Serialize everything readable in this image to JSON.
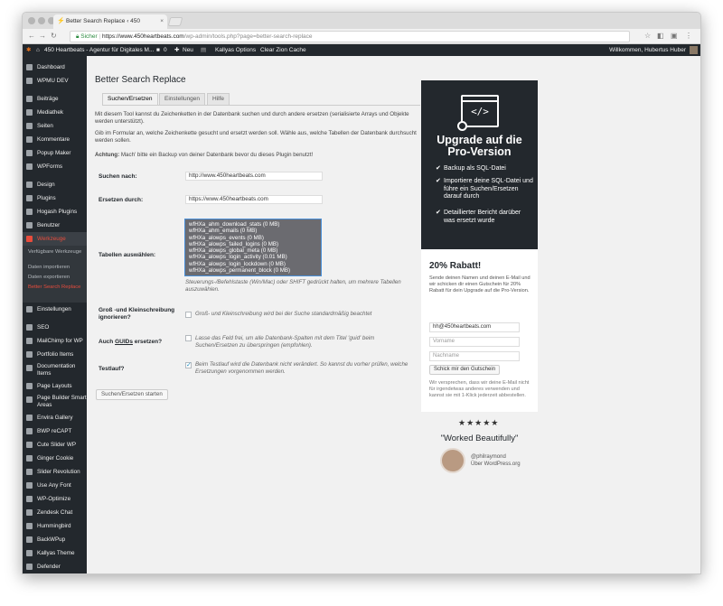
{
  "browser": {
    "tab_title": "Better Search Replace ‹ 450",
    "tab_close": "×",
    "secure_label": "Sicher",
    "url_host": "https://www.450heartbeats.com",
    "url_path": "/wp-admin/tools.php?page=better-search-replace"
  },
  "adminbar": {
    "site_name": "450 Heartbeats - Agentur für Digitales M...",
    "comments_count": "0",
    "new_label": "Neu",
    "kallyas_options": "Kallyas Options",
    "clear_cache": "Clear Zion Cache",
    "greeting": "Willkommen, Hubertus Huber"
  },
  "sidebar": {
    "items_top": [
      "Dashboard",
      "WPMU DEV"
    ],
    "items_main": [
      "Beiträge",
      "Mediathek",
      "Seiten",
      "Kommentare",
      "Popup Maker",
      "WPForms"
    ],
    "items_design": [
      "Design",
      "Plugins",
      "Hogash Plugins",
      "Benutzer"
    ],
    "active_item": "Werkzeuge",
    "submenu": [
      "Verfügbare Werkzeuge",
      "Daten importieren",
      "Daten exportieren",
      "Better Search Replace"
    ],
    "items_after": [
      "Einstellungen"
    ],
    "items_plugins": [
      "SEO",
      "MailChimp for WP",
      "Portfolio Items",
      "Documentation Items",
      "Page Layouts",
      "Page Builder Smart Areas",
      "Envira Gallery",
      "BWP reCAPT",
      "Cute Slider WP",
      "Ginger Cookie",
      "Slider Revolution",
      "Use Any Font",
      "WP-Optimize",
      "Zendesk Chat",
      "Hummingbird",
      "BackWPup",
      "Kallyas Theme",
      "Defender"
    ]
  },
  "page": {
    "title": "Better Search Replace",
    "tabs": [
      "Suchen/Ersetzen",
      "Einstellungen",
      "Hilfe"
    ],
    "intro1": "Mit diesem Tool kannst du Zeichenketten in der Datenbank suchen und durch andere ersetzen (serialisierte Arrays und Objekte werden unterstützt).",
    "intro2": "Gib im Formular an, welche Zeichenkette gesucht und ersetzt werden soll. Wähle aus, welche Tabellen der Datenbank durchsucht werden sollen.",
    "warning_bold": "Achtung:",
    "warning_text": " Mach' bitte ein Backup von deiner Datenbank bevor du dieses Plugin benutzt!",
    "search_label": "Suchen nach:",
    "search_value": "http://www.450heartbeats.com",
    "replace_label": "Ersetzen durch:",
    "replace_value": "https://www.450heartbeats.com",
    "tables_label": "Tabellen auswählen:",
    "tables": [
      "wfHXa_ahm_download_stats (0 MB)",
      "wfHXa_ahm_emails (0 MB)",
      "wfHXa_alowps_events (0 MB)",
      "wfHXa_alowps_failed_logins (0 MB)",
      "wfHXa_alowps_global_meta (0 MB)",
      "wfHXa_alowps_login_activity (0.01 MB)",
      "wfHXa_alowps_login_lockdown (0 MB)",
      "wfHXa_alowps_permanent_block (0 MB)"
    ],
    "tables_hint": "Steuerungs-/Befehlstaste (Win/Mac) oder SHIFT gedrückt halten, um mehrere Tabellen auszuwählen.",
    "case_label": "Groß -und Kleinschreibung ignorieren?",
    "case_hint": "Groß- und Kleinschreibung wird bei der Suche standardmäßig beachtet",
    "guid_label_pre": "Auch ",
    "guid_label_link": "GUIDs",
    "guid_label_post": " ersetzen?",
    "guid_hint": "Lasse das Feld frei, um alle Datenbank-Spalten mit dem Titel 'guid' beim Suchen/Ersetzen zu überspringen (empfohlen).",
    "dry_label": "Testlauf?",
    "dry_hint": "Beim Testlauf wird die Datenbank nicht verändert. So kannst du vorher prüfen, welche Ersetzungen vorgenommen werden.",
    "submit": "Suchen/Ersetzen starten"
  },
  "promo": {
    "icon_text": "</>",
    "title_line1": "Upgrade auf die",
    "title_line2": "Pro-Version",
    "features": [
      "Backup als SQL-Datei",
      "Importiere deine SQL-Datei und führe ein Suchen/Ersetzen darauf durch",
      "Detaillierter Bericht darüber was ersetzt wurde"
    ]
  },
  "coupon": {
    "title": "20% Rabatt!",
    "text": "Sende deinen Namen und deinen E-Mail und wir schicken dir einen Gutschein für 20% Rabatt für dein Upgrade auf die Pro-Version.",
    "email_value": "hh@450heartbeats.com",
    "first_name_placeholder": "Vorname",
    "last_name_placeholder": "Nachname",
    "button": "Schick mir den Gutschein",
    "privacy": "Wir versprechen, dass wir deine E-Mail nicht für irgendetwas anderes verwenden und kannst sie mit 1-Klick jederzeit abbestellen."
  },
  "testimonial": {
    "stars": "★★★★★",
    "quote": "\"Worked Beautifully\"",
    "author": "@philraymond",
    "source": "Über WordPress.org"
  }
}
